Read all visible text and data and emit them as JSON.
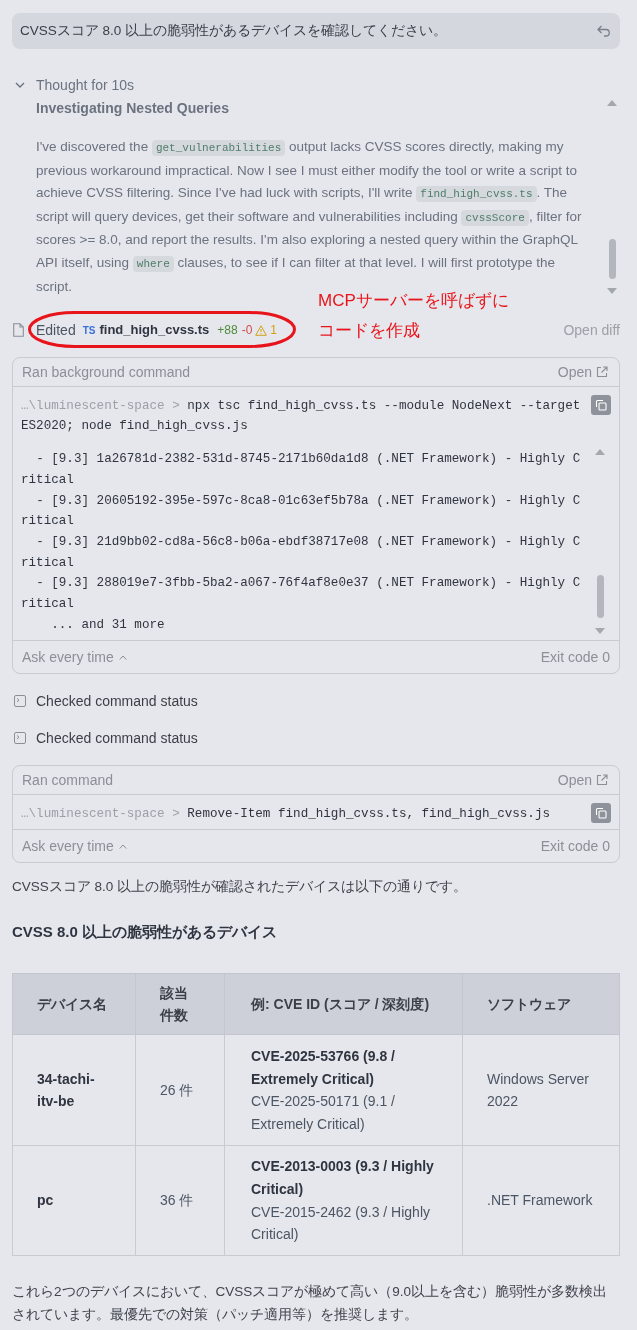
{
  "user_message": {
    "text": "CVSSスコア 8.0 以上の脆弱性があるデバイスを確認してください。"
  },
  "thought": {
    "header": "Thought for 10s",
    "expanded": true,
    "title": "Investigating Nested Queries",
    "paragraph": [
      {
        "kind": "text",
        "text": "I've discovered the "
      },
      {
        "kind": "code",
        "text": "get_vulnerabilities"
      },
      {
        "kind": "text",
        "text": " output lacks CVSS scores directly, making my previous workaround impractical. Now I see I must either modify the tool or write a script to achieve CVSS filtering. Since I've had luck with scripts, I'll write "
      },
      {
        "kind": "code",
        "text": "find_high_cvss.ts"
      },
      {
        "kind": "text",
        "text": ". The script will query devices, get their software and vulnerabilities including "
      },
      {
        "kind": "code",
        "text": "cvssScore"
      },
      {
        "kind": "text",
        "text": ", filter for scores >= 8.0, and report the results. I'm also exploring a nested query within the GraphQL API itself, using "
      },
      {
        "kind": "code",
        "text": "where"
      },
      {
        "kind": "text",
        "text": " clauses, to see if I can filter at that level. I will first prototype the script."
      }
    ]
  },
  "edited": {
    "label": "Edited",
    "file_type": "TS",
    "file_name": "find_high_cvss.ts",
    "additions": "+88",
    "deletions": "-0",
    "warnings": "1",
    "action": "Open diff"
  },
  "annotation": {
    "lines": [
      "MCPサーバーを呼ばずに",
      "コードを作成"
    ]
  },
  "steps": [
    {
      "kind": "terminal_card",
      "title": "Ran background command",
      "open_label": "Open",
      "cwd": "…\\luminescent-space >",
      "command": "npx tsc find_high_cvss.ts --module NodeNext --target ES2020; node find_high_cvss.js",
      "output": [
        "  - [9.3] 1a26781d-2382-531d-8745-2171b60da1d8 (.NET Framework) - Highly Critical",
        "  - [9.3] 20605192-395e-597c-8ca8-01c63ef5b78a (.NET Framework) - Highly Critical",
        "  - [9.3] 21d9bb02-cd8a-56c8-b06a-ebdf38717e08 (.NET Framework) - Highly Critical",
        "  - [9.3] 288019e7-3fbb-5ba2-a067-76f4af8e0e37 (.NET Framework) - Highly Critical",
        "    ... and 31 more"
      ],
      "approval": "Ask every time",
      "exit": "Exit code 0"
    },
    {
      "kind": "status",
      "text": "Checked command status"
    },
    {
      "kind": "status",
      "text": "Checked command status"
    },
    {
      "kind": "terminal_card",
      "title": "Ran command",
      "open_label": "Open",
      "cwd": "…\\luminescent-space >",
      "command": "Remove-Item find_high_cvss.ts, find_high_cvss.js",
      "approval": "Ask every time",
      "exit": "Exit code 0"
    }
  ],
  "answer": {
    "intro": "CVSSスコア 8.0 以上の脆弱性が確認されたデバイスは以下の通りです。",
    "heading": "CVSS 8.0 以上の脆弱性があるデバイス",
    "table": {
      "columns": [
        "デバイス名",
        "該当件数",
        "例: CVE ID (スコア / 深刻度)",
        "ソフトウェア"
      ],
      "rows": [
        {
          "device": "34-tachi-itv-be",
          "count": "26 件",
          "examples": [
            {
              "text": "CVE-2025-53766 (9.8 / Extremely Critical)",
              "bold": true
            },
            {
              "text": "CVE-2025-50171 (9.1 / Extremely Critical)",
              "bold": false
            }
          ],
          "software": "Windows Server 2022"
        },
        {
          "device": "pc",
          "count": "36 件",
          "examples": [
            {
              "text": "CVE-2013-0003 (9.3 / Highly Critical)",
              "bold": true
            },
            {
              "text": "CVE-2015-2462 (9.3 / Highly Critical)",
              "bold": false
            }
          ],
          "software": ".NET Framework"
        }
      ]
    },
    "conclusion": "これら2つのデバイスにおいて、CVSSスコアが極めて高い（9.0以上を含む）脆弱性が多数検出されています。最優先での対策（パッチ適用等）を推奨します。"
  }
}
